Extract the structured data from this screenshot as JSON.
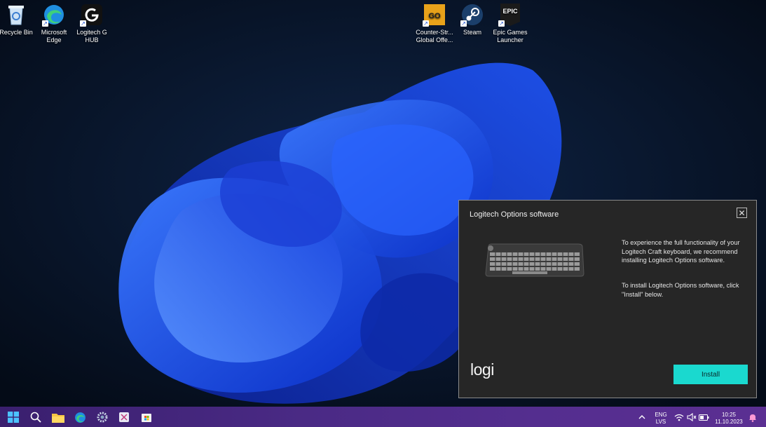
{
  "desktop": {
    "icons": [
      {
        "label": "Recycle Bin",
        "icon": "recycle-bin-icon"
      },
      {
        "label": "Microsoft Edge",
        "icon": "edge-icon"
      },
      {
        "label": "Logitech G HUB",
        "icon": "logitech-g-icon"
      },
      {
        "label": "Counter-Str... Global Offe...",
        "icon": "csgo-icon"
      },
      {
        "label": "Steam",
        "icon": "steam-icon"
      },
      {
        "label": "Epic Games Launcher",
        "icon": "epic-games-icon"
      }
    ]
  },
  "dialog": {
    "title": "Logitech Options software",
    "close_label": "✕",
    "message_1": "To experience the full functionality of your Logitech Craft keyboard, we recommend installing Logitech Options software.",
    "message_2": "To install Logitech Options software, click \"Install\" below.",
    "logo": "logi",
    "install_label": "Install",
    "accent_color": "#1ad9cf"
  },
  "taskbar": {
    "apps": [
      "start-icon",
      "search-icon",
      "file-explorer-icon",
      "edge-icon",
      "settings-icon",
      "snipping-tool-icon",
      "store-icon"
    ],
    "language_line1": "ENG",
    "language_line2": "LVS",
    "time": "10:25",
    "date": "11.10.2023",
    "tray_icons": [
      "chevron-up-icon",
      "wifi-icon",
      "volume-muted-icon",
      "battery-icon",
      "notification-bell-icon"
    ]
  }
}
